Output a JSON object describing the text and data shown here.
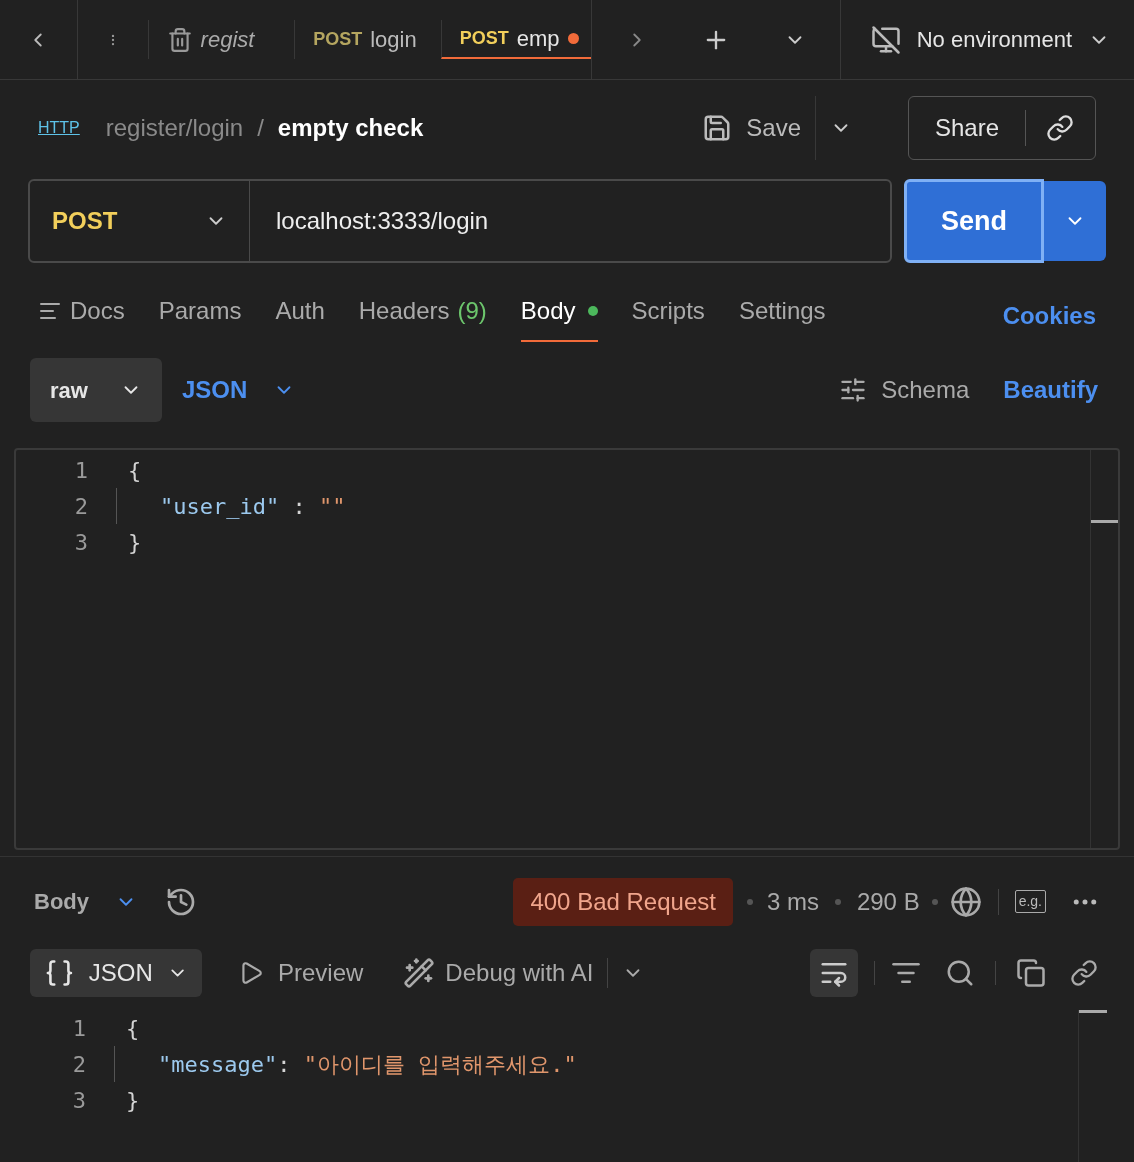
{
  "tabs": [
    {
      "kind": "collection",
      "label": "regist",
      "selected": false
    },
    {
      "kind": "request",
      "method": "POST",
      "label": "login",
      "selected": false,
      "unsaved": false
    },
    {
      "kind": "request",
      "method": "POST",
      "label": "emp",
      "selected": true,
      "unsaved": true
    }
  ],
  "environment": "No environment",
  "breadcrumb": {
    "icon_text": "HTTP",
    "parent": "register/login",
    "separator": "/",
    "current": "empty check"
  },
  "actions": {
    "save": "Save",
    "share": "Share"
  },
  "request": {
    "method": "POST",
    "url": "localhost:3333/login",
    "send": "Send"
  },
  "request_tabs": [
    {
      "label": "Docs",
      "selected": false,
      "modified": false
    },
    {
      "label": "Params",
      "selected": false,
      "modified": false
    },
    {
      "label": "Auth",
      "selected": false,
      "modified": false
    },
    {
      "label": "Headers",
      "count": "(9)",
      "selected": false,
      "modified": false
    },
    {
      "label": "Body",
      "selected": true,
      "modified": true
    },
    {
      "label": "Scripts",
      "selected": false,
      "modified": false
    },
    {
      "label": "Settings",
      "selected": false,
      "modified": false
    }
  ],
  "cookies": "Cookies",
  "body_mode": "raw",
  "body_language": "JSON",
  "schema": "Schema",
  "beautify": "Beautify",
  "request_body": [
    {
      "number": "1",
      "tokens": [
        {
          "kind": "punct",
          "text": "{"
        }
      ]
    },
    {
      "number": "2",
      "tokens": [
        {
          "kind": "key",
          "text": "\"user_id\""
        },
        {
          "kind": "punct",
          "text": " : "
        },
        {
          "kind": "string",
          "text": "\"\""
        }
      ]
    },
    {
      "number": "3",
      "tokens": [
        {
          "kind": "punct",
          "text": "}"
        }
      ]
    }
  ],
  "response": {
    "section": "Body",
    "status": "400 Bad Request",
    "time": "3 ms",
    "size": "290 B",
    "example": "e.g.",
    "format": "JSON",
    "preview": "Preview",
    "debug": "Debug with AI"
  },
  "response_body": [
    {
      "number": "1",
      "tokens": [
        {
          "kind": "punct",
          "text": "{"
        }
      ]
    },
    {
      "number": "2",
      "tokens": [
        {
          "kind": "key",
          "text": "\"message\""
        },
        {
          "kind": "punct",
          "text": ": "
        },
        {
          "kind": "string",
          "text": "\"아이디를 입력해주세요.\""
        }
      ]
    },
    {
      "number": "3",
      "tokens": [
        {
          "kind": "punct",
          "text": "}"
        }
      ]
    }
  ]
}
